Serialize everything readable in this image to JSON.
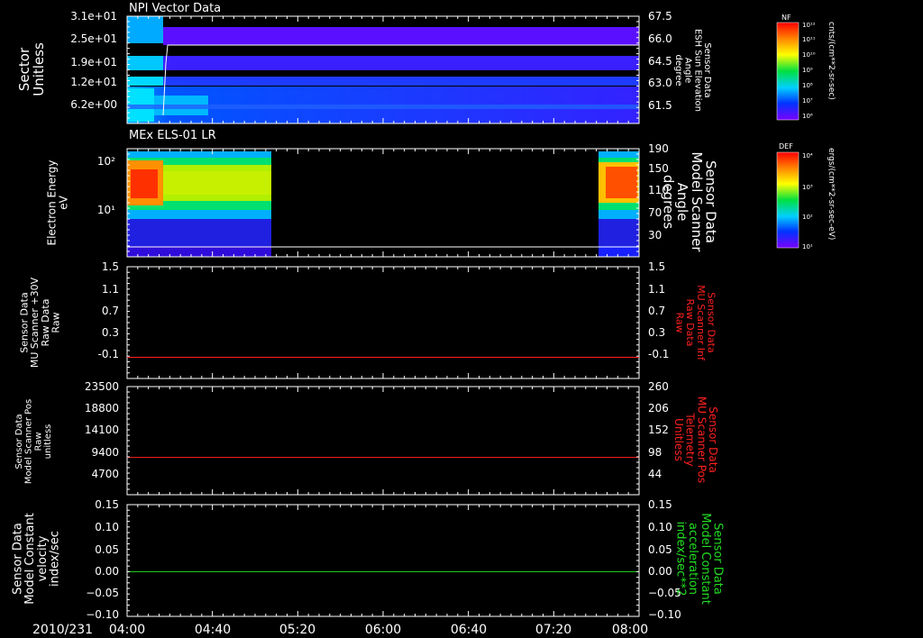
{
  "date_label": "2010/231",
  "x_ticks": [
    "04:00",
    "04:40",
    "05:20",
    "06:00",
    "06:40",
    "07:20",
    "08:00"
  ],
  "colors": {
    "white": "#ffffff",
    "red": "#ff2020",
    "green": "#22dd22",
    "background": "#000000"
  },
  "colorbars": [
    {
      "label": "NF",
      "units": "cnts/(cm**2-sr-sec)",
      "ticks": [
        "10¹²",
        "10¹¹",
        "10¹⁰",
        "10⁹",
        "10⁸",
        "10⁷",
        "10⁶"
      ]
    },
    {
      "label": "DEF",
      "units": "ergs/(cm**2-sr-sec-eV)",
      "ticks": [
        "10⁴",
        "10³",
        "10²",
        "10¹"
      ]
    }
  ],
  "chart_data": [
    {
      "type": "heatmap",
      "title": "NPI Vector Data",
      "ylabel": "Sector\nUnitless",
      "y_ticks": [
        "3.1e+01",
        "2.5e+01",
        "1.9e+01",
        "1.2e+01",
        "6.2e+00"
      ],
      "ylabel_right": "Sensor Data\nESH Sun Elevation\nAngle\ndegree",
      "y2_ticks": [
        "67.5",
        "66.0",
        "64.5",
        "63.0",
        "61.5"
      ],
      "x_range": [
        "04:00",
        "08:00"
      ]
    },
    {
      "type": "heatmap",
      "title": "MEx ELS-01 LR",
      "ylabel": "Electron Energy\neV",
      "y_ticks": [
        "10²",
        "10¹"
      ],
      "ylabel_right": "Sensor Data\nModel Scanner\nAngle\ndegrees",
      "y2_ticks": [
        "190",
        "150",
        "110",
        "70",
        "30"
      ],
      "data_coverage": [
        [
          "04:00",
          "05:08"
        ],
        [
          "07:33",
          "08:00"
        ]
      ]
    },
    {
      "type": "line",
      "ylabel": "Sensor Data\nMU Scanner +30V\nRaw Data\nRaw",
      "y_ticks": [
        "1.5",
        "1.1",
        "0.7",
        "0.3",
        "-0.1"
      ],
      "ylabel_right": "Sensor Data\nMU Scanner Inf\nRaw Data\nRaw",
      "y2_ticks": [
        "1.5",
        "1.1",
        "0.7",
        "0.3",
        "-0.1"
      ],
      "ylim": [
        -0.35,
        1.5
      ],
      "series": [
        {
          "color": "#ff2020",
          "y": 0
        }
      ]
    },
    {
      "type": "line",
      "ylabel": "Sensor Data\nModel Scanner Pos\nRaw\nunitless",
      "y_ticks": [
        "23500",
        "18800",
        "14100",
        "9400",
        "4700"
      ],
      "ylabel_right": "Sensor Data\nMU Scanner Pos\nTelemetry\nUnitless",
      "y2_ticks": [
        "260",
        "206",
        "152",
        "98",
        "44"
      ],
      "ylim": [
        0,
        23500
      ],
      "series": [
        {
          "color": "#ff2020",
          "y": 8100
        }
      ]
    },
    {
      "type": "line",
      "ylabel": "Sensor Data\nModel Constant\nvelocity\nindex/sec",
      "y_ticks": [
        "0.15",
        "0.10",
        "0.05",
        "0.00",
        "−0.05",
        "−0.10"
      ],
      "ylabel_right": "Sensor Data\nModel Constant\nacceleration\nindex/sec**2",
      "y2_ticks": [
        "0.15",
        "0.10",
        "0.05",
        "0.00",
        "−0.05",
        "−0.10"
      ],
      "ylim": [
        -0.1,
        0.15
      ],
      "series": [
        {
          "color": "#22dd22",
          "y": 0
        }
      ]
    }
  ]
}
